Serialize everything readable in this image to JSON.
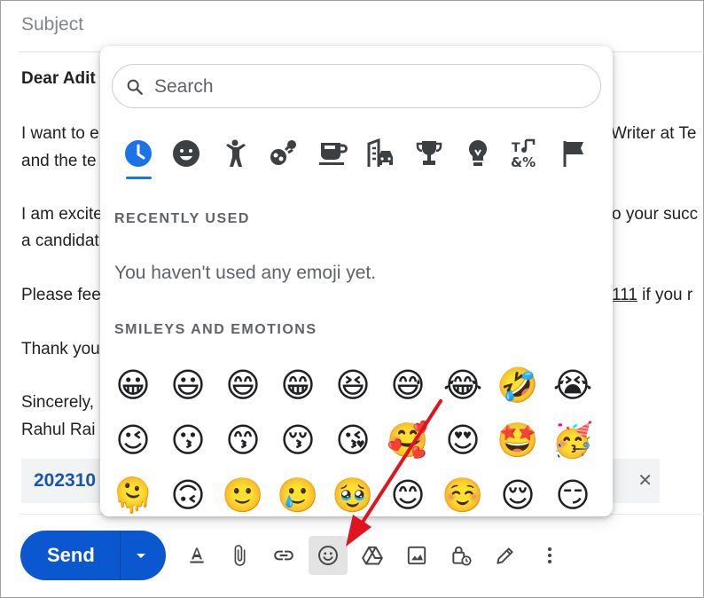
{
  "compose": {
    "subject_placeholder": "Subject",
    "lines": [
      {
        "left": "Dear Adit"
      },
      {
        "left": "I want to e",
        "right": "Writer at Te"
      },
      {
        "left": "and the te"
      },
      {
        "left": "I am excite",
        "right": "o your succ"
      },
      {
        "left": "a candidat"
      },
      {
        "left": "Please fee",
        "right_link": "111",
        "right": " if you r"
      },
      {
        "left": "Thank you"
      },
      {
        "left": "Sincerely,"
      },
      {
        "left": "Rahul Rai"
      }
    ],
    "attachment_name": "202310",
    "attachment_close": "✕"
  },
  "toolbar": {
    "send_label": "Send",
    "tools": [
      "formatting-options",
      "attach-files",
      "insert-link",
      "insert-emoji",
      "insert-from-drive",
      "insert-photo",
      "confidential-mode",
      "insert-signature",
      "more-options"
    ]
  },
  "emoji_picker": {
    "search_placeholder": "Search",
    "categories": [
      "recent",
      "smileys",
      "people",
      "animals-nature",
      "food-drink",
      "travel-places",
      "activities",
      "objects",
      "symbols",
      "flags"
    ],
    "recent_title": "RECENTLY USED",
    "recent_empty": "You haven't used any emoji yet.",
    "smileys_title": "SMILEYS AND EMOTIONS",
    "smileys": [
      [
        "😀",
        "😃",
        "😄",
        "😁",
        "😆",
        "😅",
        "😂",
        "🤣",
        "😭"
      ],
      [
        "😉",
        "😗",
        "😙",
        "😚",
        "😘",
        "🥰",
        "😍",
        "🤩",
        "🥳"
      ],
      [
        "🫠",
        "🙃",
        "🙂",
        "🥲",
        "🥹",
        "😊",
        "☺️",
        "😌",
        "😏"
      ]
    ]
  },
  "colors": {
    "send_blue": "#0b57d0",
    "accent_blue": "#1a73e8",
    "arrow_red": "#e0141e",
    "emoji_yellow": "#fcc21b"
  }
}
